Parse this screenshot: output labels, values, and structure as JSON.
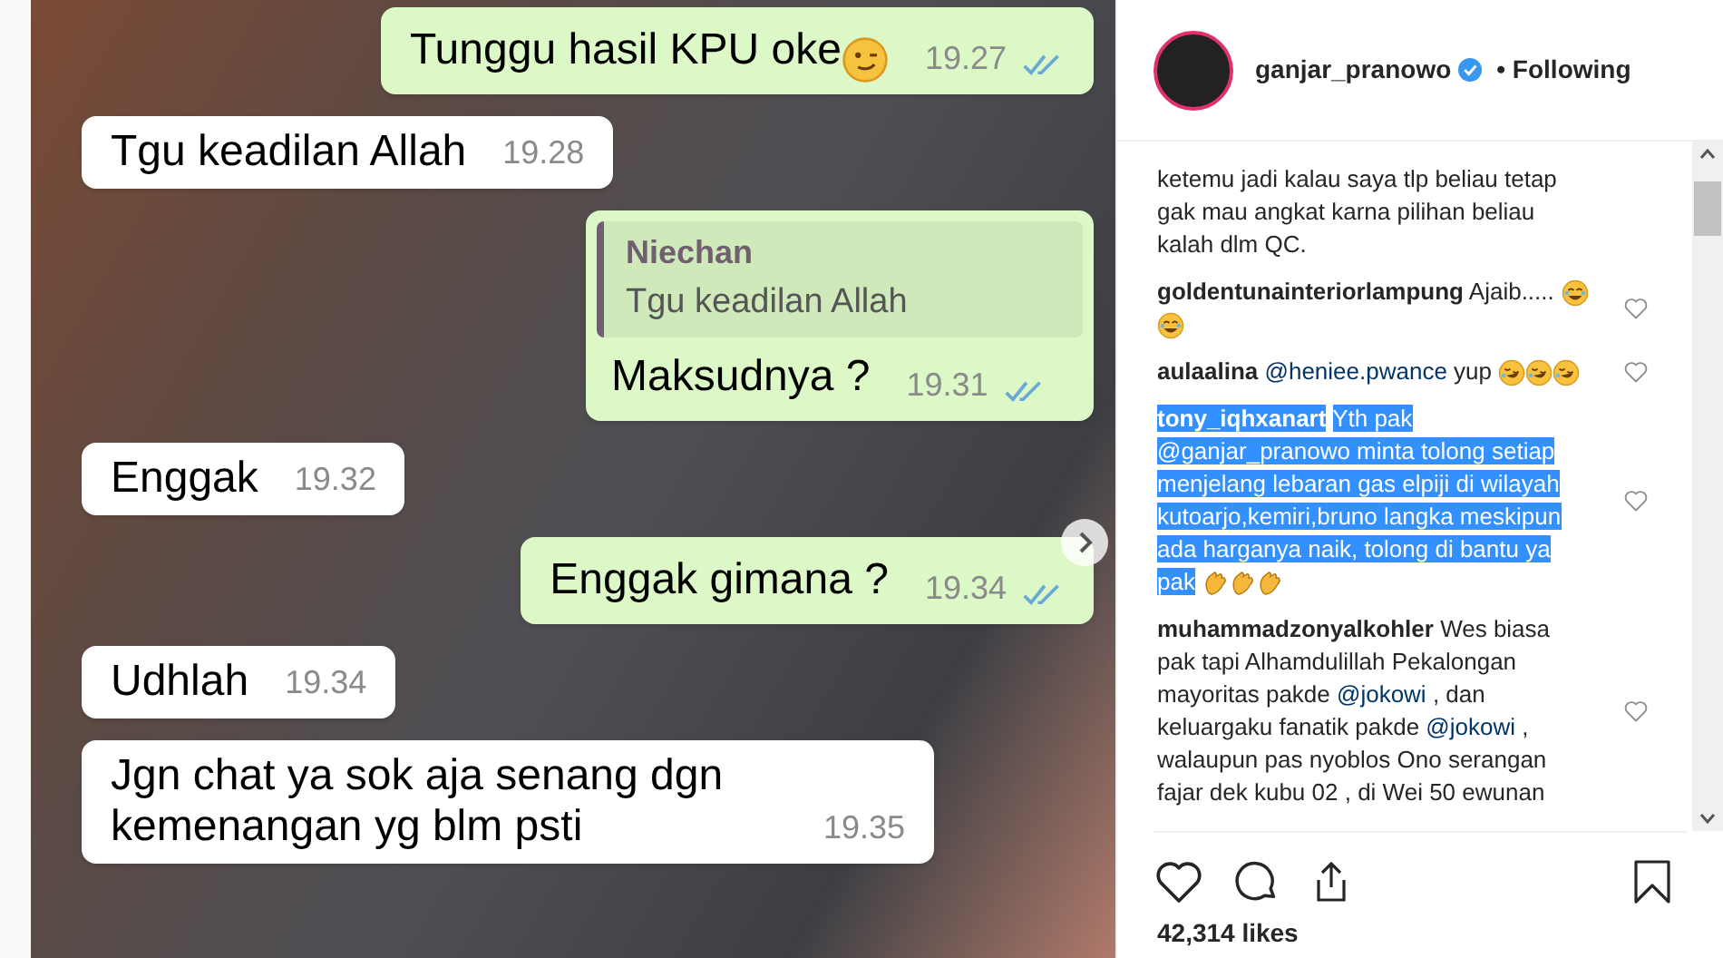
{
  "chat": {
    "messages": [
      {
        "kind": "sent",
        "text": "Tunggu hasil KPU oke",
        "emoji": {
          "kind": "wink"
        },
        "time": "19.27",
        "read": true
      },
      {
        "kind": "received",
        "text": "Tgu keadilan Allah",
        "time": "19.28"
      },
      {
        "kind": "reply",
        "quote_author": "Niechan",
        "quote_text": "Tgu keadilan Allah",
        "text": "Maksudnya ?",
        "time": "19.31",
        "read": true
      },
      {
        "kind": "received",
        "text": "Enggak",
        "time": "19.32"
      },
      {
        "kind": "sent",
        "text": "Enggak gimana ?",
        "time": "19.34",
        "read": true
      },
      {
        "kind": "received",
        "text": "Udhlah",
        "time": "19.34"
      },
      {
        "kind": "received",
        "text": "Jgn chat ya sok aja senang dgn kemenangan yg blm psti",
        "time": "19.35"
      }
    ]
  },
  "post": {
    "username": "ganjar_pranowo",
    "verified": true,
    "follow_status": "• Following",
    "comments": [
      {
        "segments": [
          {
            "kind": "plain",
            "text": "ketemu jadi kalau saya tlp beliau tetap gak mau angkat karna pilihan beliau kalah dlm QC."
          }
        ],
        "highlighted": false,
        "heart": false
      },
      {
        "username": "goldentunainteriorlampung",
        "segments": [
          {
            "kind": "plain",
            "text": "Ajaib....."
          }
        ],
        "emojis": [
          {
            "kind": "laugh"
          },
          {
            "kind": "laugh"
          }
        ],
        "highlighted": false,
        "heart": true
      },
      {
        "username": "aulaalina",
        "segments": [
          {
            "kind": "mention",
            "text": "@heniee.pwance"
          },
          {
            "kind": "plain",
            "text": " yup"
          }
        ],
        "emojis": [
          {
            "kind": "rofl"
          },
          {
            "kind": "rofl"
          },
          {
            "kind": "rofl"
          }
        ],
        "highlighted": false,
        "heart": true
      },
      {
        "username": "tony_iqhxanart",
        "segments": [
          {
            "kind": "plain",
            "text": "Yth pak @ganjar_pranowo minta tolong setiap menjelang lebaran gas elpiji di wilayah kutoarjo,kemiri,bruno langka meskipun ada harganya naik, tolong di bantu ya pak"
          }
        ],
        "emojis": [
          {
            "kind": "clap"
          },
          {
            "kind": "clap"
          },
          {
            "kind": "clap"
          }
        ],
        "highlighted": true,
        "heart": true
      },
      {
        "username": "muhammadzonyalkohler",
        "segments": [
          {
            "kind": "plain",
            "text": "Wes biasa pak tapi Alhamdulillah Pekalongan mayoritas pakde "
          },
          {
            "kind": "mention",
            "text": "@jokowi"
          },
          {
            "kind": "plain",
            "text": " , dan keluargaku fanatik pakde "
          },
          {
            "kind": "mention",
            "text": "@jokowi"
          },
          {
            "kind": "plain",
            "text": " , walaupun pas nyoblos Ono serangan fajar dek kubu 02 , di Wei 50 ewunan"
          }
        ],
        "highlighted": false,
        "heart": true
      }
    ],
    "likes": "42,314 likes"
  }
}
